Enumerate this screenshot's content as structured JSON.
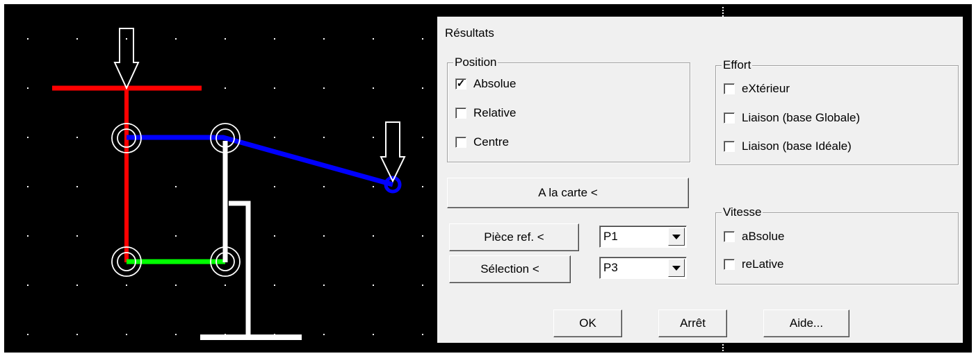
{
  "dialog": {
    "title": "Résultats",
    "position_group": {
      "label": "Position",
      "options": [
        {
          "label": "Absolue",
          "checked": true
        },
        {
          "label": "Relative",
          "checked": false
        },
        {
          "label": "Centre",
          "checked": false
        }
      ]
    },
    "effort_group": {
      "label": "Effort",
      "options": [
        {
          "label": "eXtérieur",
          "checked": false
        },
        {
          "label": "Liaison (base Globale)",
          "checked": false
        },
        {
          "label": "Liaison (base Idéale)",
          "checked": false
        }
      ]
    },
    "vitesse_group": {
      "label": "Vitesse",
      "options": [
        {
          "label": "aBsolue",
          "checked": false
        },
        {
          "label": "reLative",
          "checked": false
        }
      ]
    },
    "a_la_carte_button": "A la carte <",
    "piece_ref_button": "Pièce ref. <",
    "piece_ref_value": "P1",
    "selection_button": "Sélection <",
    "selection_value": "P3",
    "ok_button": "OK",
    "stop_button": "Arrêt",
    "help_button": "Aide..."
  },
  "colors": {
    "canvas_background": "#000000",
    "grid_dot": "#ffffff",
    "bar_red": "#ff0000",
    "bar_blue": "#0000ff",
    "bar_green": "#00ff00",
    "frame_white": "#ffffff",
    "dialog_background": "#f0f0f0"
  },
  "icons": [
    "down-arrow-icon",
    "check-mark-icon",
    "combo-arrow-icon"
  ]
}
